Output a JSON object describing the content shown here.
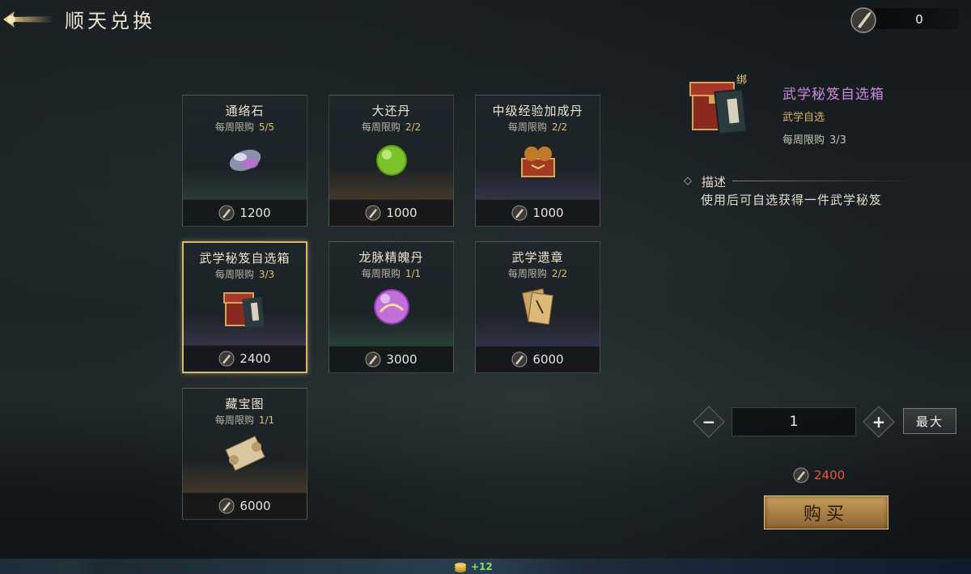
{
  "header": {
    "title": "顺天兑换",
    "currency_amount": "0",
    "back_icon": "back-arrow-icon",
    "currency_icon": "token-icon"
  },
  "shop": {
    "limit_label": "每周限购",
    "items": [
      {
        "name": "通络石",
        "limit": "5/5",
        "price": "1200",
        "icon": "gem-icon"
      },
      {
        "name": "大还丹",
        "limit": "2/2",
        "price": "1000",
        "icon": "green-pill-icon"
      },
      {
        "name": "中级经验加成丹",
        "limit": "2/2",
        "price": "1000",
        "icon": "pill-box-icon"
      },
      {
        "name": "武学秘笈自选箱",
        "limit": "3/3",
        "price": "2400",
        "icon": "chest-icon"
      },
      {
        "name": "龙脉精魄丹",
        "limit": "1/1",
        "price": "3000",
        "icon": "dragon-orb-icon"
      },
      {
        "name": "武学遗章",
        "limit": "2/2",
        "price": "6000",
        "icon": "scroll-pages-icon"
      },
      {
        "name": "藏宝图",
        "limit": "1/1",
        "price": "6000",
        "icon": "treasure-map-icon"
      }
    ]
  },
  "detail": {
    "bound_tag": "绑",
    "name": "武学秘笈自选箱",
    "category": "武学自选",
    "limit_label": "每周限购",
    "limit": "3/3",
    "desc_label": "描述",
    "description": "使用后可自选获得一件武学秘笈",
    "quantity": "1",
    "max_label": "最大",
    "total": "2400",
    "buy_label": "购买"
  },
  "bottom": {
    "coin_gain": "+12"
  },
  "colors": {
    "accent_gold": "#d9b86a",
    "item_name_purple": "#c98be0",
    "price_red": "#e5554a"
  }
}
